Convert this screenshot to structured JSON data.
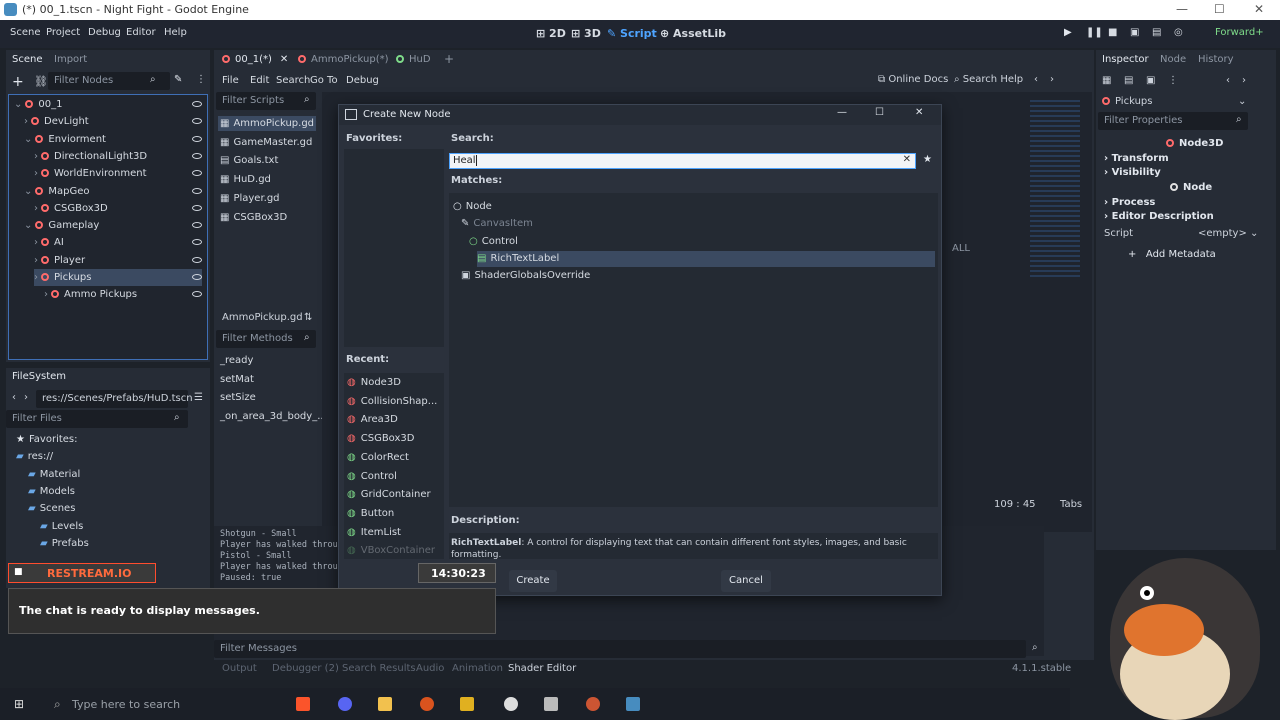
{
  "window": {
    "title": "(*) 00_1.tscn - Night Fight - Godot Engine"
  },
  "menu": [
    "Scene",
    "Project",
    "Debug",
    "Editor",
    "Help"
  ],
  "workspaces": [
    {
      "label": "2D",
      "active": false
    },
    {
      "label": "3D",
      "active": false
    },
    {
      "label": "Script",
      "active": true
    },
    {
      "label": "AssetLib",
      "active": false
    }
  ],
  "renderer": "Forward+",
  "scene_dock": {
    "tabs": [
      "Scene",
      "Import"
    ],
    "filter_placeholder": "Filter Nodes",
    "tree": [
      {
        "label": "00_1",
        "indent": 0
      },
      {
        "label": "DevLight",
        "indent": 1
      },
      {
        "label": "Enviorment",
        "indent": 1
      },
      {
        "label": "DirectionalLight3D",
        "indent": 2
      },
      {
        "label": "WorldEnvironment",
        "indent": 2
      },
      {
        "label": "MapGeo",
        "indent": 1
      },
      {
        "label": "CSGBox3D",
        "indent": 2
      },
      {
        "label": "Gameplay",
        "indent": 1
      },
      {
        "label": "AI",
        "indent": 2
      },
      {
        "label": "Player",
        "indent": 2
      },
      {
        "label": "Pickups",
        "indent": 2
      },
      {
        "label": "Ammo Pickups",
        "indent": 3
      }
    ]
  },
  "filesystem": {
    "tab": "FileSystem",
    "path": "res://Scenes/Prefabs/HuD.tscn",
    "filter_placeholder": "Filter Files",
    "items": [
      "Favorites:",
      "res://",
      "Material",
      "Models",
      "Scenes",
      "Levels",
      "Prefabs"
    ]
  },
  "script_tabs": [
    {
      "label": "00_1(*)",
      "active": true
    },
    {
      "label": "AmmoPickup(*)",
      "active": false
    },
    {
      "label": "HuD",
      "active": false
    }
  ],
  "script_menu": [
    "File",
    "Edit",
    "Search",
    "Go To",
    "Debug"
  ],
  "script_toolbar": {
    "online_docs": "Online Docs",
    "search_help": "Search Help"
  },
  "scripts_list": {
    "filter_placeholder": "Filter Scripts",
    "items": [
      "AmmoPickup.gd",
      "GameMaster.gd",
      "Goals.txt",
      "HuD.gd",
      "Player.gd",
      "CSGBox3D"
    ],
    "current": "AmmoPickup.gd",
    "methods_filter_placeholder": "Filter Methods",
    "methods": [
      "_ready",
      "setMat",
      "setSize",
      "_on_area_3d_body_..."
    ]
  },
  "editor_status": {
    "position": "109 :  45",
    "indent": "Tabs",
    "word": "ALL"
  },
  "output_lines": [
    "Shotgun - Small",
    "Player has walked throu...",
    "Pistol - Small",
    "Player has walked throu...",
    "Paused: true"
  ],
  "bottom_tabs": [
    "Output",
    "Debugger (2)",
    "Search Results",
    "Audio",
    "Animation",
    "Shader Editor"
  ],
  "version": "4.1.1.stable",
  "filter_messages": "Filter Messages",
  "inspector": {
    "tabs": [
      "Inspector",
      "Node",
      "History"
    ],
    "node_name": "Pickups",
    "filter_placeholder": "Filter Properties",
    "class_name": "Node3D",
    "sections": [
      "Transform",
      "Visibility"
    ],
    "node_header": "Node",
    "node_sections": [
      "Process",
      "Editor Description"
    ],
    "script_label": "Script",
    "script_value": "<empty>",
    "add_metadata": "Add Metadata"
  },
  "dialog": {
    "title": "Create New Node",
    "favorites_label": "Favorites:",
    "search_label": "Search:",
    "search_value": "Heal",
    "matches_label": "Matches:",
    "matches": [
      {
        "label": "Node",
        "indent": 0,
        "dim": false,
        "selected": false,
        "icon": "circle"
      },
      {
        "label": "CanvasItem",
        "indent": 1,
        "dim": true,
        "selected": false,
        "icon": "pen"
      },
      {
        "label": "Control",
        "indent": 2,
        "dim": false,
        "selected": false,
        "icon": "circle-green"
      },
      {
        "label": "RichTextLabel",
        "indent": 3,
        "dim": false,
        "selected": true,
        "icon": "text"
      },
      {
        "label": "ShaderGlobalsOverride",
        "indent": 1,
        "dim": false,
        "selected": false,
        "icon": "box"
      }
    ],
    "recent_label": "Recent:",
    "recent": [
      {
        "label": "Node3D",
        "color": "#ff6b6b"
      },
      {
        "label": "CollisionShap...",
        "color": "#ff6b6b"
      },
      {
        "label": "Area3D",
        "color": "#ff6b6b"
      },
      {
        "label": "CSGBox3D",
        "color": "#ff6b6b"
      },
      {
        "label": "ColorRect",
        "color": "#7fdc8a"
      },
      {
        "label": "Control",
        "color": "#7fdc8a"
      },
      {
        "label": "GridContainer",
        "color": "#7fdc8a"
      },
      {
        "label": "Button",
        "color": "#7fdc8a"
      },
      {
        "label": "ItemList",
        "color": "#7fdc8a"
      },
      {
        "label": "VBoxContainer",
        "color": "#7fdc8a"
      }
    ],
    "description_label": "Description:",
    "description_name": "RichTextLabel",
    "description_text": ": A control for displaying text that can contain different font styles, images, and basic formatting.",
    "create": "Create",
    "cancel": "Cancel"
  },
  "overlay": {
    "brand": "RESTREAM.IO",
    "time": "14:30:23",
    "message": "The chat is ready to display messages."
  },
  "taskbar": {
    "search_placeholder": "Type here to search"
  },
  "colors": {
    "accent": "#4ea4ff",
    "selected": "#3b4a61",
    "node3d": "#ff6b6b",
    "control": "#7fdc8a"
  }
}
